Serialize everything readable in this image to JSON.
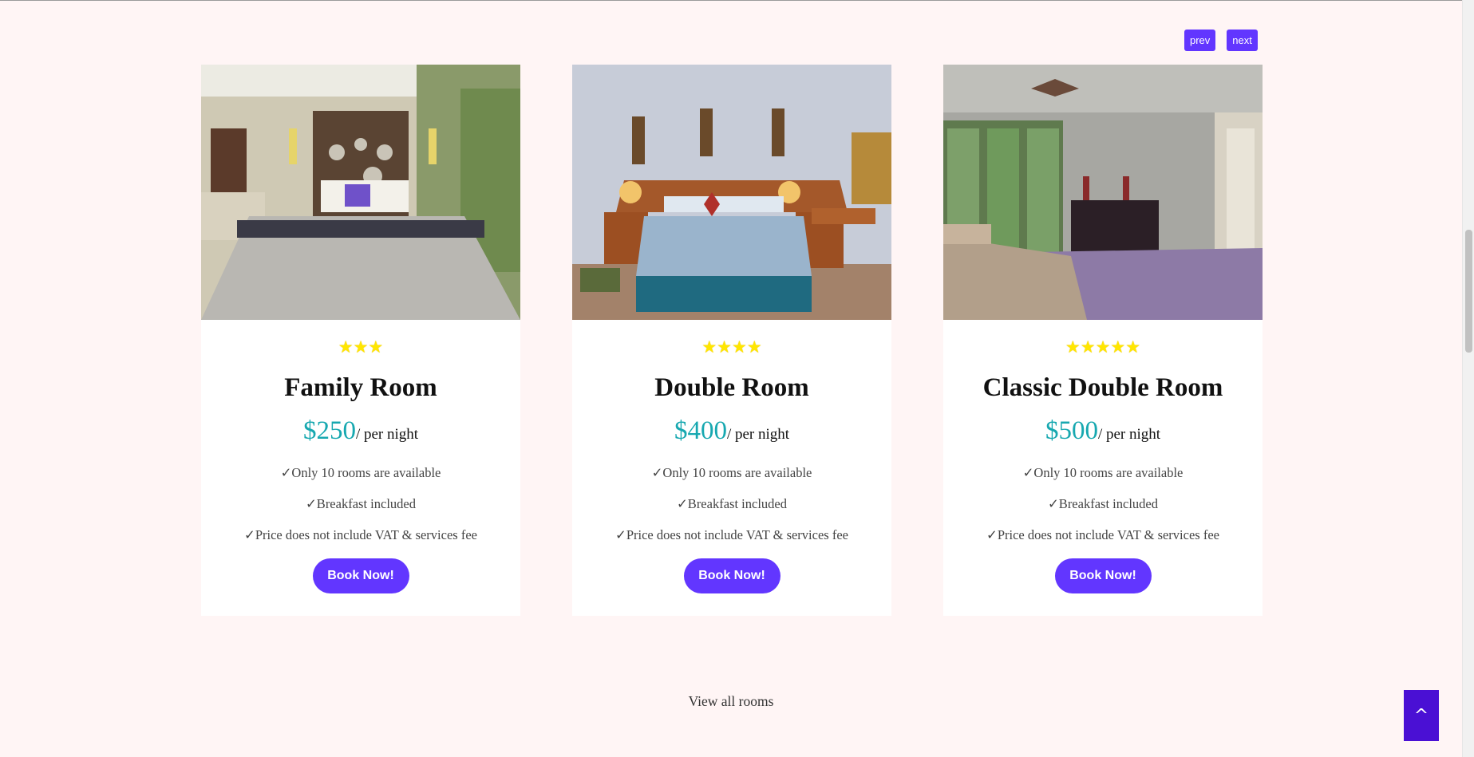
{
  "pager": {
    "prev_label": "prev",
    "next_label": "next"
  },
  "rooms": [
    {
      "star_count": 3,
      "stars": "★★★",
      "title": "Family Room",
      "price": "$250",
      "per_night": "/ per night",
      "features": [
        "✓Only 10 rooms are available",
        "✓Breakfast included",
        "✓Price does not include VAT & services fee"
      ],
      "book_label": "Book Now!"
    },
    {
      "star_count": 4,
      "stars": "★★★★",
      "title": "Double Room",
      "price": "$400",
      "per_night": "/ per night",
      "features": [
        "✓Only 10 rooms are available",
        "✓Breakfast included",
        "✓Price does not include VAT & services fee"
      ],
      "book_label": "Book Now!"
    },
    {
      "star_count": 5,
      "stars": "★★★★★",
      "title": "Classic Double Room",
      "price": "$500",
      "per_night": "/ per night",
      "features": [
        "✓Only 10 rooms are available",
        "✓Breakfast included",
        "✓Price does not include VAT & services fee"
      ],
      "book_label": "Book Now!"
    }
  ],
  "view_all_label": "View all rooms",
  "scroll_top_label": "^",
  "colors": {
    "accent": "#6236ff",
    "price": "#17a8b0",
    "star": "#ffe600",
    "background": "#fff5f5",
    "scroll_top": "#4a10d4"
  }
}
